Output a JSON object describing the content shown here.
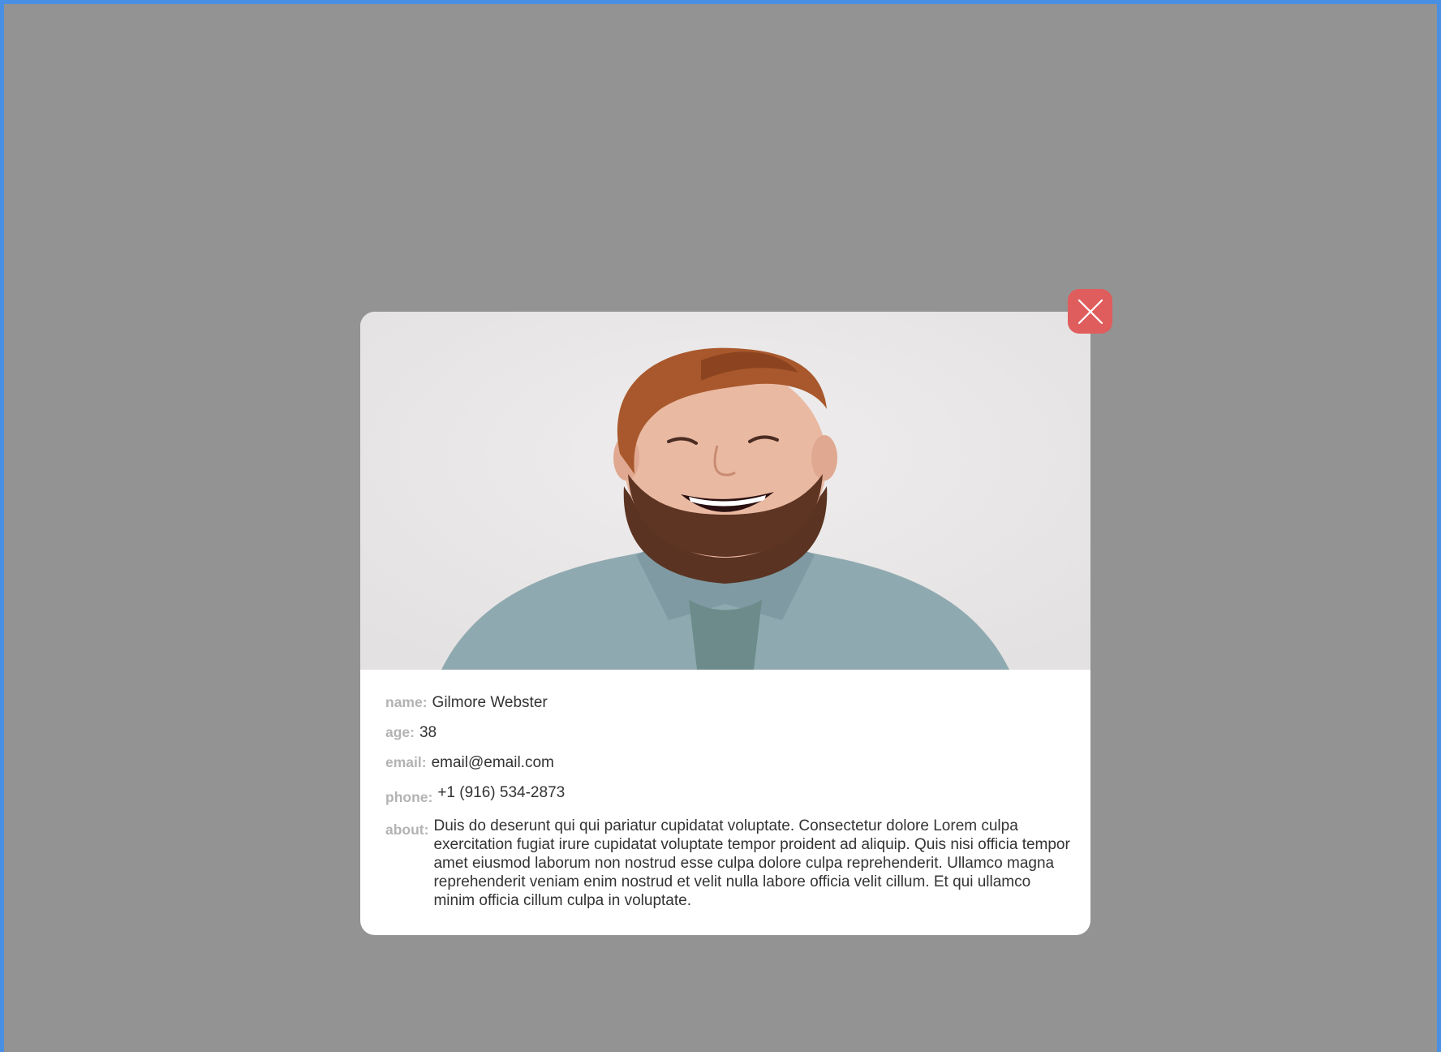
{
  "modal": {
    "photo": {
      "icon": "person-photo",
      "colors": {
        "background": "#ebe9e9",
        "shirt": "#8aa6ad",
        "beard": "#5a3322",
        "hair": "#a8582c"
      }
    },
    "close": {
      "icon": "close-icon",
      "color": "#e05d5d"
    },
    "fields": {
      "name_label": "name:",
      "name_value": "Gilmore Webster",
      "age_label": "age:",
      "age_value": "38",
      "email_label": "email:",
      "email_value": "email@email.com",
      "phone_label": "phone:",
      "phone_value": "+1 (916) 534-2873",
      "about_label": "about:",
      "about_value": "Duis do deserunt qui qui pariatur cupidatat voluptate. Consectetur dolore Lorem culpa exercitation fugiat irure cupidatat voluptate tempor proident ad aliquip. Quis nisi officia tempor amet eiusmod laborum non nostrud esse culpa dolore culpa reprehenderit. Ullamco magna reprehenderit veniam enim nostrud et velit nulla labore officia velit cillum. Et qui ullamco minim officia cillum culpa in voluptate."
    }
  },
  "overlay": {
    "color": "#939393",
    "border_color": "#4a90e2"
  }
}
